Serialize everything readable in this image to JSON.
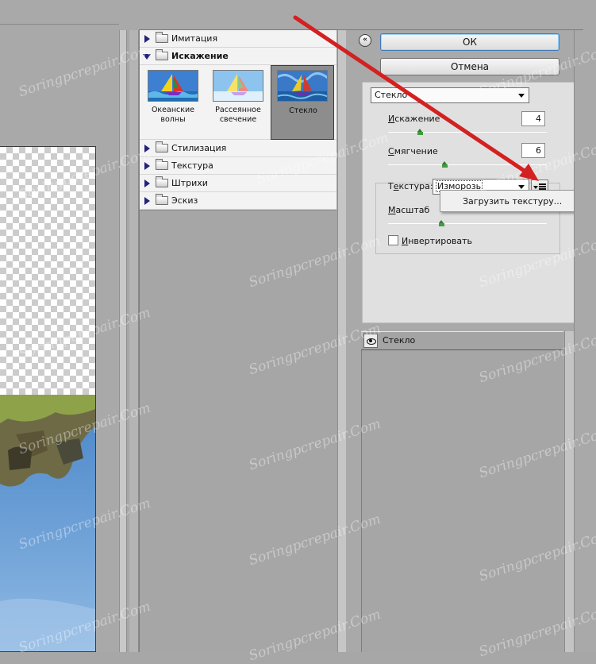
{
  "gallery": {
    "categories": [
      {
        "label": "Имитация",
        "expanded": false
      },
      {
        "label": "Искажение",
        "expanded": true
      },
      {
        "label": "Стилизация",
        "expanded": false
      },
      {
        "label": "Текстура",
        "expanded": false
      },
      {
        "label": "Штрихи",
        "expanded": false
      },
      {
        "label": "Эскиз",
        "expanded": false
      }
    ],
    "thumbnails": [
      {
        "label": "Океанские волны",
        "selected": false
      },
      {
        "label": "Рассеянное свечение",
        "selected": false
      },
      {
        "label": "Стекло",
        "selected": true
      }
    ]
  },
  "buttons": {
    "ok": "ОК",
    "cancel": "Отмена"
  },
  "filter": {
    "selected": "Стекло",
    "distortion": {
      "label_u": "И",
      "label_rest": "скажение",
      "value": "4"
    },
    "smoothing": {
      "label_u": "С",
      "label_rest": "мягчение",
      "value": "6"
    },
    "texture": {
      "label_pre": "Т",
      "label_u": "е",
      "label_rest": "кстура:",
      "value": "Изморозь"
    },
    "scale": {
      "label_pre": "",
      "label_u": "М",
      "label_rest": "асштаб"
    },
    "invert": {
      "label_u": "И",
      "label_rest": "нвертировать",
      "checked": false
    }
  },
  "texture_menu": {
    "load_texture": "Загрузить текстуру..."
  },
  "layers": {
    "items": [
      {
        "name": "Стекло",
        "visible": true
      }
    ]
  },
  "watermark": "Soringpcrepair.Com",
  "colors": {
    "annotation_arrow": "#d42020",
    "slider_green": "#3f9d3f",
    "ok_focus": "#3d7bbd"
  }
}
